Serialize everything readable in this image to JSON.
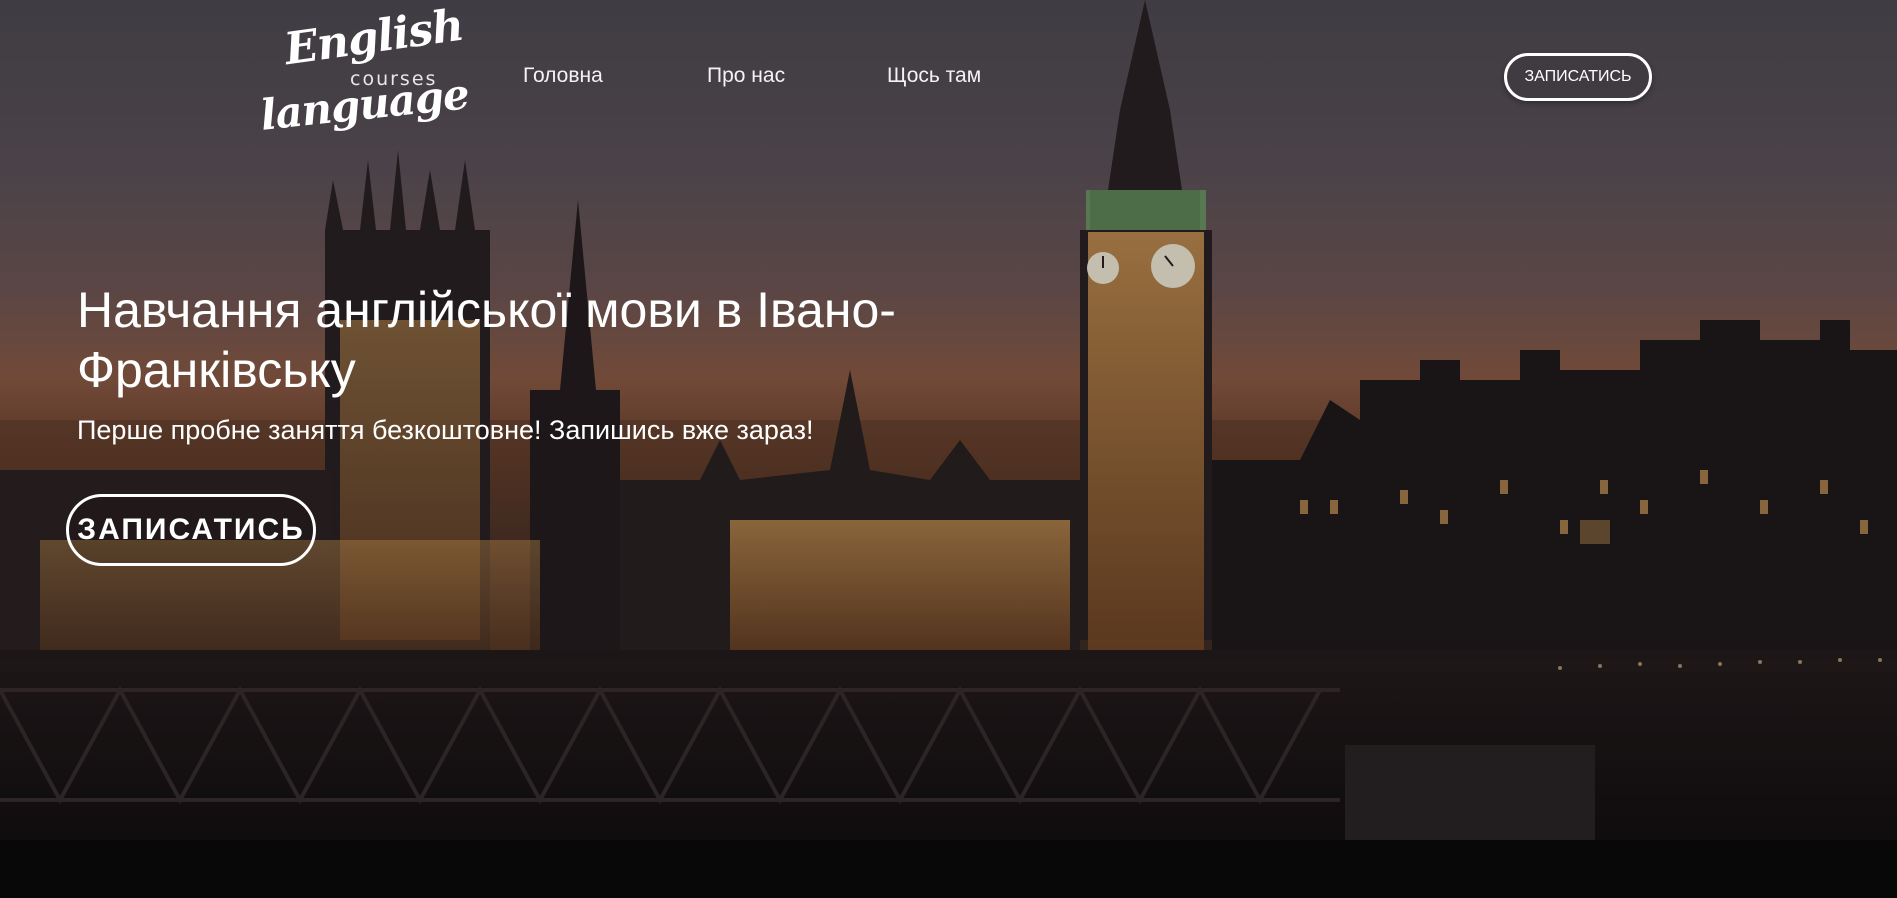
{
  "logo": {
    "word1": "English",
    "word2": "courses",
    "word3": "language"
  },
  "nav": {
    "items": [
      {
        "label": "Головна"
      },
      {
        "label": "Про нас"
      },
      {
        "label": "Щось там"
      }
    ],
    "cta_label": "ЗАПИСАТИСЬ"
  },
  "hero": {
    "title": "Навчання англійської мови в Івано-Франківську",
    "subtitle": "Перше пробне заняття безкоштовне! Запишись вже зараз!",
    "cta_label": "ЗАПИСАТИСЬ",
    "background": "London skyline at dusk with Big Ben and Houses of Parliament"
  },
  "colors": {
    "text": "#ffffff",
    "sky_top": "#4e4a52",
    "sky_glow": "#8a5a45",
    "buildings_lit": "#c48a4a",
    "water": "#121011"
  }
}
